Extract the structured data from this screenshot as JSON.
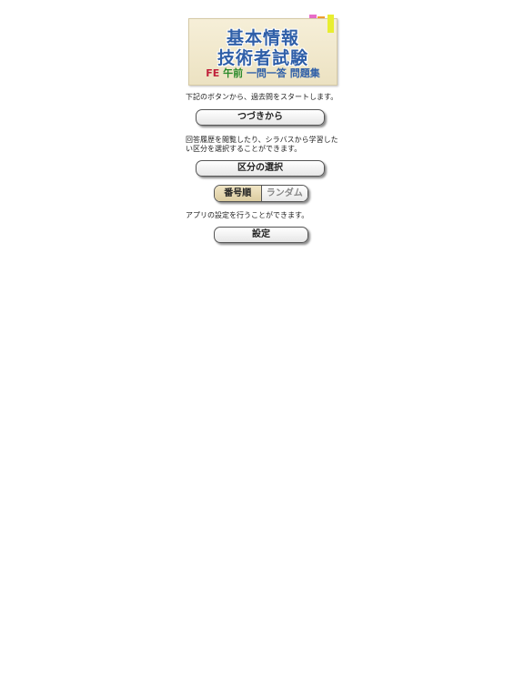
{
  "logo": {
    "line1": "基本情報",
    "line2": "技術者試験",
    "sub_fe": "FE",
    "sub_am": "午前",
    "sub_q": "一問一答 問題集"
  },
  "start": {
    "description": "下記のボタンから、過去問をスタートします。",
    "continue_label": "つづきから"
  },
  "category": {
    "description": "回答履歴を閲覧したり、シラバスから学習したい区分を選択することができます。",
    "select_label": "区分の選択"
  },
  "order": {
    "options": [
      "番号順",
      "ランダム"
    ],
    "selected": "番号順"
  },
  "settings": {
    "description": "アプリの設定を行うことができます。",
    "button_label": "設定"
  },
  "colors": {
    "logo_blue": "#2f5fa8",
    "fe_red": "#c0203a",
    "am_green": "#2a8a2a",
    "segment_selected": "#e6d9b2"
  }
}
